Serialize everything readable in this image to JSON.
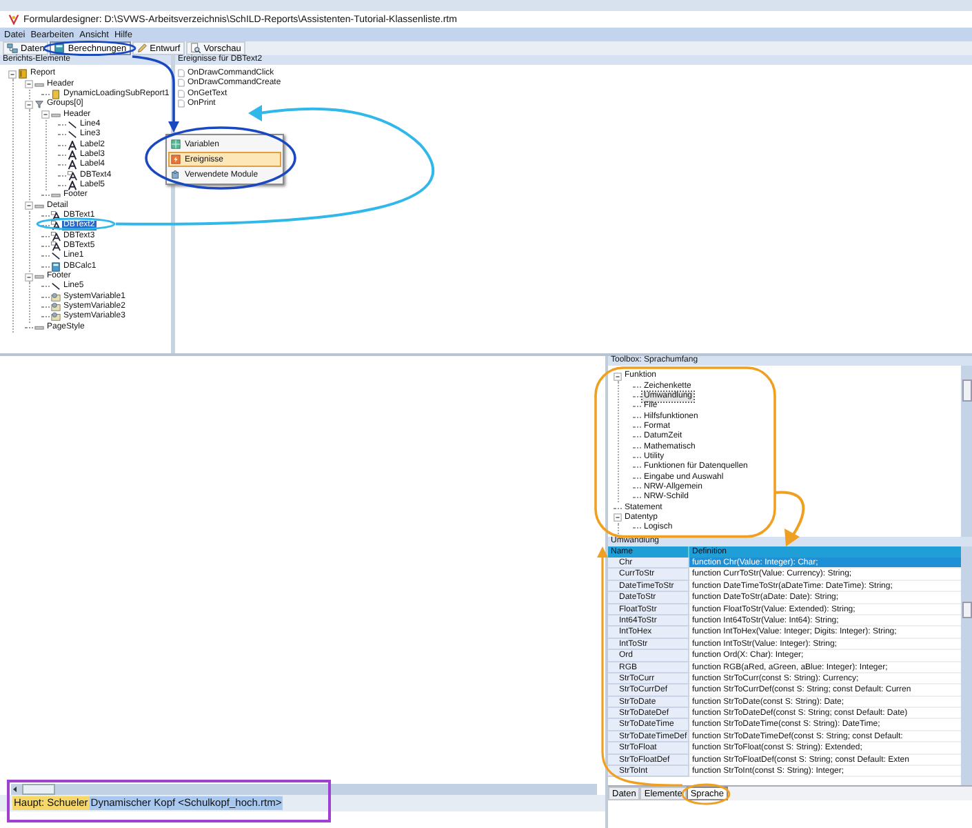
{
  "window": {
    "title": "Formulardesigner: D:\\SVWS-Arbeitsverzeichnis\\SchILD-Reports\\Assistenten-Tutorial-Klassenliste.rtm"
  },
  "menu": [
    "Datei",
    "Bearbeiten",
    "Ansicht",
    "Hilfe"
  ],
  "toolbar_tabs": [
    {
      "label": "Daten",
      "kind": "data",
      "selected": false
    },
    {
      "label": "Berechnungen",
      "kind": "calc",
      "selected": true
    },
    {
      "label": "Entwurf",
      "kind": "design",
      "selected": false
    },
    {
      "label": "Vorschau",
      "kind": "preview",
      "selected": false
    }
  ],
  "elements_panel": {
    "title": "Berichts-Elemente",
    "tree": [
      {
        "label": "Report",
        "kind": "report",
        "selected": false,
        "expanded": true,
        "children": [
          {
            "label": "Header",
            "kind": "band",
            "selected": false,
            "expanded": true,
            "children": [
              {
                "label": "DynamicLoadingSubReport1",
                "kind": "subreport",
                "selected": false
              }
            ]
          },
          {
            "label": "Groups[0]",
            "kind": "group",
            "selected": false,
            "expanded": true,
            "children": [
              {
                "label": "Header",
                "kind": "band",
                "selected": false,
                "expanded": true,
                "children": [
                  {
                    "label": "Line4",
                    "kind": "line",
                    "selected": false
                  },
                  {
                    "label": "Line3",
                    "kind": "line",
                    "selected": false
                  },
                  {
                    "label": "Label2",
                    "kind": "label",
                    "selected": false
                  },
                  {
                    "label": "Label3",
                    "kind": "label",
                    "selected": false
                  },
                  {
                    "label": "Label4",
                    "kind": "label",
                    "selected": false
                  },
                  {
                    "label": "DBText4",
                    "kind": "dbtext",
                    "selected": false
                  },
                  {
                    "label": "Label5",
                    "kind": "label",
                    "selected": false
                  }
                ]
              },
              {
                "label": "Footer",
                "kind": "band",
                "selected": false
              }
            ]
          },
          {
            "label": "Detail",
            "kind": "band",
            "selected": false,
            "expanded": true,
            "children": [
              {
                "label": "DBText1",
                "kind": "dbtext",
                "selected": false
              },
              {
                "label": "DBText2",
                "kind": "dbtext",
                "selected": true
              },
              {
                "label": "DBText3",
                "kind": "dbtext",
                "selected": false
              },
              {
                "label": "DBText5",
                "kind": "dbtext",
                "selected": false
              },
              {
                "label": "Line1",
                "kind": "line",
                "selected": false
              },
              {
                "label": "DBCalc1",
                "kind": "dbcalc",
                "selected": false
              }
            ]
          },
          {
            "label": "Footer",
            "kind": "band",
            "selected": false,
            "expanded": true,
            "children": [
              {
                "label": "Line5",
                "kind": "line",
                "selected": false
              },
              {
                "label": "SystemVariable1",
                "kind": "sysvar",
                "selected": false
              },
              {
                "label": "SystemVariable2",
                "kind": "sysvar",
                "selected": false
              },
              {
                "label": "SystemVariable3",
                "kind": "sysvar",
                "selected": false
              }
            ]
          },
          {
            "label": "PageStyle",
            "kind": "band",
            "selected": false
          }
        ]
      }
    ]
  },
  "events_panel": {
    "title": "Ereignisse für DBText2",
    "items": [
      "OnDrawCommandClick",
      "OnDrawCommandCreate",
      "OnGetText",
      "OnPrint"
    ]
  },
  "popup_menu": [
    {
      "label": "Variablen",
      "kind": "variables",
      "selected": false
    },
    {
      "label": "Ereignisse",
      "kind": "events",
      "selected": true
    },
    {
      "label": "Verwendete Module",
      "kind": "modules",
      "selected": false
    }
  ],
  "toolbox": {
    "title": "Toolbox: Sprachumfang",
    "tree": [
      {
        "label": "Funktion",
        "selected": false,
        "expanded": true,
        "children": [
          {
            "label": "Zeichenkette",
            "selected": false
          },
          {
            "label": "Umwandlung",
            "selected": true
          },
          {
            "label": "File",
            "selected": false
          },
          {
            "label": "Hilfsfunktionen",
            "selected": false
          },
          {
            "label": "Format",
            "selected": false
          },
          {
            "label": "DatumZeit",
            "selected": false
          },
          {
            "label": "Mathematisch",
            "selected": false
          },
          {
            "label": "Utility",
            "selected": false
          },
          {
            "label": "Funktionen für Datenquellen",
            "selected": false
          },
          {
            "label": "Eingabe und Auswahl",
            "selected": false
          },
          {
            "label": "NRW-Allgemein",
            "selected": false
          },
          {
            "label": "NRW-Schild",
            "selected": false
          }
        ]
      },
      {
        "label": "Statement",
        "selected": false
      },
      {
        "label": "Datentyp",
        "selected": false,
        "expanded": true,
        "children": [
          {
            "label": "Logisch",
            "selected": false
          }
        ]
      }
    ]
  },
  "functions_table": {
    "title": "Umwandlung",
    "columns": [
      "Name",
      "Definition"
    ],
    "rows": [
      {
        "name": "Chr",
        "definition": "function Chr(Value: Integer): Char;",
        "selected": true
      },
      {
        "name": "CurrToStr",
        "definition": "function CurrToStr(Value: Currency): String;",
        "selected": false
      },
      {
        "name": "DateTimeToStr",
        "definition": "function DateTimeToStr(aDateTime: DateTime): String;",
        "selected": false
      },
      {
        "name": "DateToStr",
        "definition": "function DateToStr(aDate: Date): String;",
        "selected": false
      },
      {
        "name": "FloatToStr",
        "definition": "function FloatToStr(Value: Extended): String;",
        "selected": false
      },
      {
        "name": "Int64ToStr",
        "definition": "function Int64ToStr(Value: Int64): String;",
        "selected": false
      },
      {
        "name": "IntToHex",
        "definition": "function IntToHex(Value: Integer; Digits: Integer): String;",
        "selected": false
      },
      {
        "name": "IntToStr",
        "definition": "function IntToStr(Value: Integer): String;",
        "selected": false
      },
      {
        "name": "Ord",
        "definition": "function Ord(X: Char): Integer;",
        "selected": false
      },
      {
        "name": "RGB",
        "definition": "function RGB(aRed, aGreen, aBlue: Integer): Integer;",
        "selected": false
      },
      {
        "name": "StrToCurr",
        "definition": "function StrToCurr(const S: String): Currency;",
        "selected": false
      },
      {
        "name": "StrToCurrDef",
        "definition": "function StrToCurrDef(const S: String; const Default: Curren",
        "selected": false
      },
      {
        "name": "StrToDate",
        "definition": "function StrToDate(const S: String): Date;",
        "selected": false
      },
      {
        "name": "StrToDateDef",
        "definition": "function StrToDateDef(const S: String; const Default: Date)",
        "selected": false
      },
      {
        "name": "StrToDateTime",
        "definition": "function StrToDateTime(const S: String): DateTime;",
        "selected": false
      },
      {
        "name": "StrToDateTimeDef",
        "definition": "function StrToDateTimeDef(const S: String; const Default:",
        "selected": false
      },
      {
        "name": "StrToFloat",
        "definition": "function StrToFloat(const S: String): Extended;",
        "selected": false
      },
      {
        "name": "StrToFloatDef",
        "definition": "function StrToFloatDef(const S: String; const Default: Exten",
        "selected": false
      },
      {
        "name": "StrToInt",
        "definition": "function StrToInt(const S: String): Integer;",
        "selected": false
      }
    ]
  },
  "bottom_tabs": [
    {
      "label": "Daten",
      "selected": false
    },
    {
      "label": "Elemente",
      "selected": false
    },
    {
      "label": "Sprache",
      "selected": true
    }
  ],
  "status_bar": [
    {
      "text": "Haupt: Schueler",
      "kind": "main"
    },
    {
      "text": "Dynamischer Kopf <Schulkopf_hoch.rtm>",
      "kind": "sub"
    }
  ]
}
